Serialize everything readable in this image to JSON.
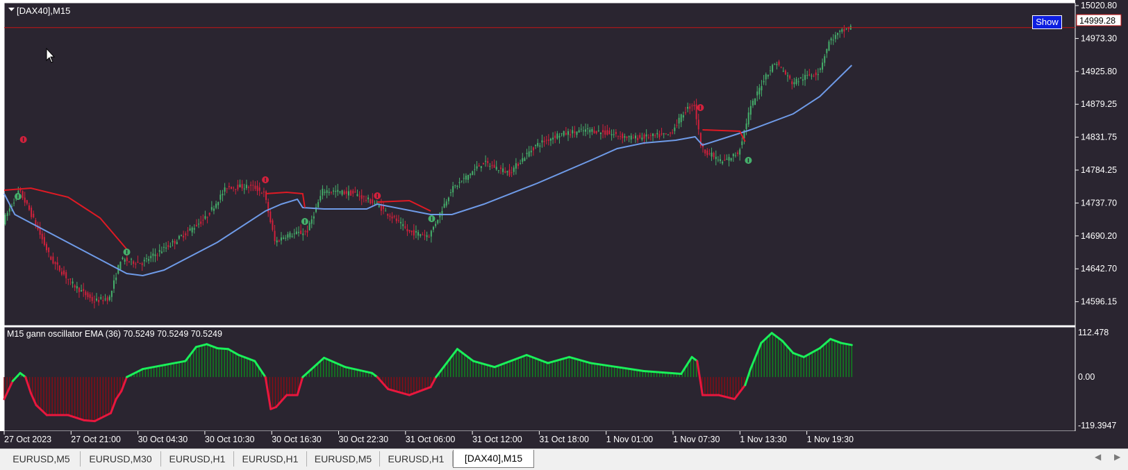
{
  "window": {
    "symbol_title": "[DAX40],M15",
    "show_button_label": "Show",
    "current_price_label": "14999.28"
  },
  "colors": {
    "background": "#2a2530",
    "bull_candle": "#45b06b",
    "bear_candle": "#d2213c",
    "ma_blue": "#6f9be8",
    "ma_red": "#e01a24",
    "osc_positive_line": "#1af05a",
    "osc_positive_fill": "#0e8a1e",
    "osc_negative_line": "#e8173e",
    "osc_negative_fill": "#8a0c14",
    "current_price_line": "#c81414"
  },
  "price_axis": {
    "labels": [
      "15020.80",
      "14973.30",
      "14925.80",
      "14879.25",
      "14831.75",
      "14784.25",
      "14737.70",
      "14690.20",
      "14642.70",
      "14596.15"
    ]
  },
  "oscillator": {
    "label": "M15 gann oscillator EMA (36)  70.5249 70.5249 70.5249",
    "axis_labels": [
      "112.478",
      "0.00",
      "-119.3947"
    ]
  },
  "time_axis": {
    "labels": [
      "27 Oct 2023",
      "27 Oct 21:00",
      "30 Oct 04:30",
      "30 Oct 10:30",
      "30 Oct 16:30",
      "30 Oct 22:30",
      "31 Oct 06:00",
      "31 Oct 12:00",
      "31 Oct 18:00",
      "1 Nov 01:00",
      "1 Nov 07:30",
      "1 Nov 13:30",
      "1 Nov 19:30"
    ]
  },
  "tabs": [
    {
      "label": "EURUSD,M5",
      "active": false
    },
    {
      "label": "EURUSD,M30",
      "active": false
    },
    {
      "label": "EURUSD,H1",
      "active": false
    },
    {
      "label": "EURUSD,H1",
      "active": false
    },
    {
      "label": "EURUSD,M5",
      "active": false
    },
    {
      "label": "EURUSD,H1",
      "active": false
    },
    {
      "label": "[DAX40],M15",
      "active": true
    }
  ],
  "chart_data": [
    {
      "type": "candlestick",
      "title": "[DAX40],M15",
      "ylim": [
        14596.15,
        15020.8
      ],
      "current_price": 14999.28,
      "price_path": [
        [
          0,
          14720
        ],
        [
          0.015,
          14765
        ],
        [
          0.025,
          14735
        ],
        [
          0.045,
          14665
        ],
        [
          0.065,
          14630
        ],
        [
          0.085,
          14605
        ],
        [
          0.1,
          14610
        ],
        [
          0.11,
          14665
        ],
        [
          0.13,
          14660
        ],
        [
          0.16,
          14690
        ],
        [
          0.19,
          14725
        ],
        [
          0.21,
          14770
        ],
        [
          0.235,
          14770
        ],
        [
          0.245,
          14760
        ],
        [
          0.255,
          14690
        ],
        [
          0.265,
          14700
        ],
        [
          0.285,
          14705
        ],
        [
          0.3,
          14765
        ],
        [
          0.33,
          14760
        ],
        [
          0.35,
          14745
        ],
        [
          0.37,
          14720
        ],
        [
          0.38,
          14705
        ],
        [
          0.4,
          14700
        ],
        [
          0.42,
          14765
        ],
        [
          0.45,
          14805
        ],
        [
          0.475,
          14790
        ],
        [
          0.49,
          14815
        ],
        [
          0.5,
          14830
        ],
        [
          0.52,
          14845
        ],
        [
          0.55,
          14852
        ],
        [
          0.59,
          14840
        ],
        [
          0.625,
          14845
        ],
        [
          0.64,
          14880
        ],
        [
          0.648,
          14890
        ],
        [
          0.655,
          14825
        ],
        [
          0.675,
          14805
        ],
        [
          0.69,
          14820
        ],
        [
          0.7,
          14880
        ],
        [
          0.715,
          14930
        ],
        [
          0.725,
          14950
        ],
        [
          0.74,
          14920
        ],
        [
          0.755,
          14930
        ],
        [
          0.765,
          14935
        ],
        [
          0.775,
          14980
        ],
        [
          0.785,
          14992
        ],
        [
          0.795,
          15000
        ]
      ],
      "blue_ma": [
        [
          0,
          14760
        ],
        [
          0.01,
          14730
        ],
        [
          0.115,
          14645
        ],
        [
          0.13,
          14642
        ],
        [
          0.15,
          14650
        ],
        [
          0.2,
          14690
        ],
        [
          0.245,
          14735
        ],
        [
          0.26,
          14745
        ],
        [
          0.275,
          14752
        ],
        [
          0.28,
          14740
        ],
        [
          0.3,
          14738
        ],
        [
          0.34,
          14738
        ],
        [
          0.35,
          14745
        ],
        [
          0.4,
          14730
        ],
        [
          0.42,
          14730
        ],
        [
          0.45,
          14745
        ],
        [
          0.5,
          14775
        ],
        [
          0.55,
          14808
        ],
        [
          0.575,
          14825
        ],
        [
          0.6,
          14833
        ],
        [
          0.63,
          14837
        ],
        [
          0.648,
          14842
        ],
        [
          0.655,
          14830
        ],
        [
          0.7,
          14852
        ],
        [
          0.74,
          14875
        ],
        [
          0.765,
          14900
        ],
        [
          0.795,
          14945
        ]
      ],
      "red_ma": [
        {
          "points": [
            [
              0,
              14765
            ],
            [
              0.025,
              14768
            ],
            [
              0.06,
              14755
            ],
            [
              0.09,
              14725
            ],
            [
              0.115,
              14680
            ]
          ]
        },
        {
          "points": [
            [
              0.245,
              14760
            ],
            [
              0.265,
              14762
            ],
            [
              0.28,
              14760
            ],
            [
              0.282,
              14740
            ]
          ]
        },
        {
          "points": [
            [
              0.35,
              14748
            ],
            [
              0.38,
              14750
            ],
            [
              0.4,
              14735
            ]
          ]
        },
        {
          "points": [
            [
              0.655,
              14852
            ],
            [
              0.69,
              14850
            ],
            [
              0.695,
              14835
            ]
          ]
        }
      ],
      "signals": [
        {
          "t": 0.018,
          "price": 14838,
          "dir": "down"
        },
        {
          "t": 0.013,
          "price": 14756,
          "dir": "up"
        },
        {
          "t": 0.115,
          "price": 14676,
          "dir": "up"
        },
        {
          "t": 0.245,
          "price": 14780,
          "dir": "down"
        },
        {
          "t": 0.282,
          "price": 14720,
          "dir": "up"
        },
        {
          "t": 0.35,
          "price": 14757,
          "dir": "down"
        },
        {
          "t": 0.401,
          "price": 14724,
          "dir": "up"
        },
        {
          "t": 0.653,
          "price": 14884,
          "dir": "down"
        },
        {
          "t": 0.698,
          "price": 14808,
          "dir": "up"
        }
      ]
    },
    {
      "type": "histogram",
      "title": "M15 gann oscillator EMA (36)",
      "ylim": [
        -119.3947,
        112.478
      ],
      "last_value": 70.5249,
      "values_path": [
        [
          0,
          -55
        ],
        [
          0.008,
          -10
        ],
        [
          0.015,
          10
        ],
        [
          0.02,
          0
        ],
        [
          0.025,
          -40
        ],
        [
          0.03,
          -70
        ],
        [
          0.04,
          -95
        ],
        [
          0.06,
          -95
        ],
        [
          0.075,
          -108
        ],
        [
          0.085,
          -110
        ],
        [
          0.1,
          -90
        ],
        [
          0.105,
          -55
        ],
        [
          0.11,
          -35
        ],
        [
          0.115,
          0
        ],
        [
          0.13,
          20
        ],
        [
          0.15,
          30
        ],
        [
          0.17,
          40
        ],
        [
          0.18,
          75
        ],
        [
          0.19,
          82
        ],
        [
          0.2,
          72
        ],
        [
          0.21,
          70
        ],
        [
          0.22,
          55
        ],
        [
          0.235,
          40
        ],
        [
          0.245,
          0
        ],
        [
          0.25,
          -80
        ],
        [
          0.255,
          -75
        ],
        [
          0.265,
          -45
        ],
        [
          0.275,
          -45
        ],
        [
          0.28,
          0
        ],
        [
          0.3,
          48
        ],
        [
          0.32,
          25
        ],
        [
          0.345,
          10
        ],
        [
          0.35,
          0
        ],
        [
          0.36,
          -30
        ],
        [
          0.38,
          -45
        ],
        [
          0.4,
          -25
        ],
        [
          0.405,
          0
        ],
        [
          0.425,
          70
        ],
        [
          0.44,
          40
        ],
        [
          0.46,
          25
        ],
        [
          0.49,
          55
        ],
        [
          0.51,
          35
        ],
        [
          0.53,
          50
        ],
        [
          0.55,
          35
        ],
        [
          0.575,
          25
        ],
        [
          0.6,
          15
        ],
        [
          0.635,
          8
        ],
        [
          0.645,
          50
        ],
        [
          0.65,
          40
        ],
        [
          0.655,
          -45
        ],
        [
          0.67,
          -45
        ],
        [
          0.685,
          -55
        ],
        [
          0.695,
          -20
        ],
        [
          0.7,
          20
        ],
        [
          0.71,
          85
        ],
        [
          0.72,
          110
        ],
        [
          0.73,
          90
        ],
        [
          0.74,
          60
        ],
        [
          0.75,
          50
        ],
        [
          0.765,
          72
        ],
        [
          0.775,
          95
        ],
        [
          0.785,
          85
        ],
        [
          0.795,
          80
        ]
      ]
    }
  ]
}
